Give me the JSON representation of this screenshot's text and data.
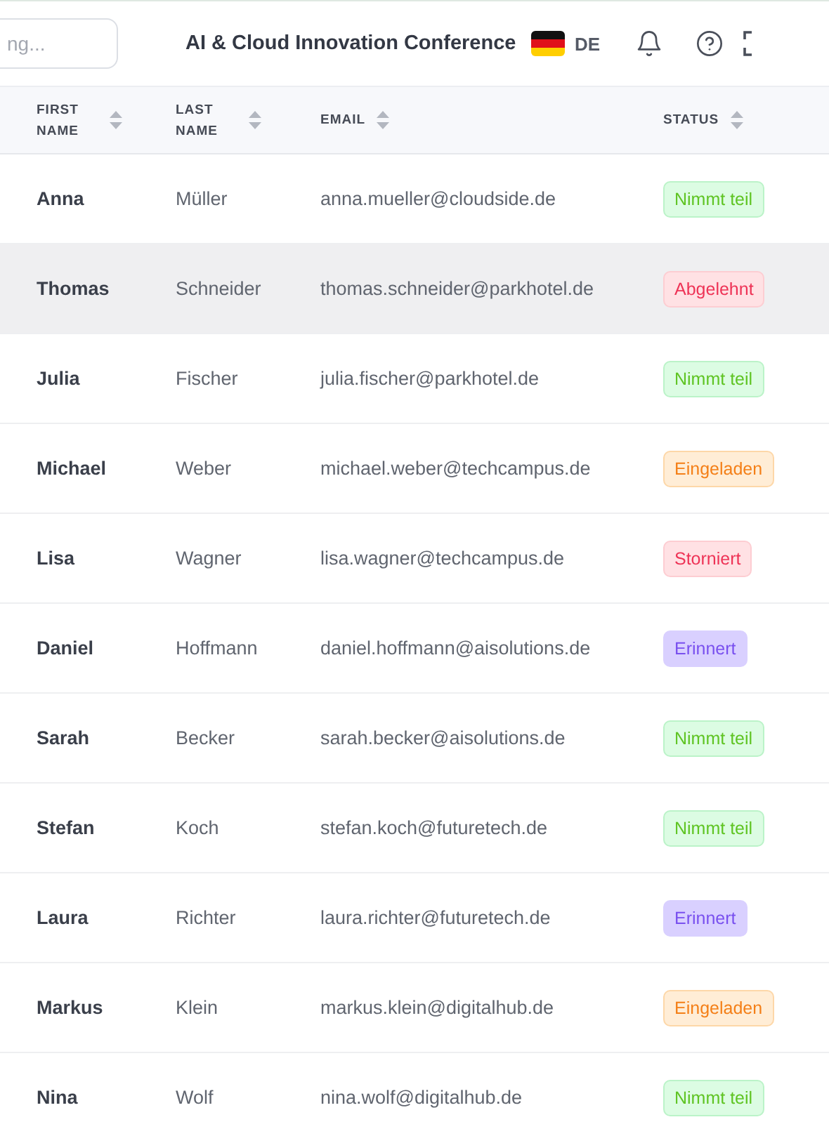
{
  "header": {
    "search": {
      "placeholder": "ng..."
    },
    "title": "AI & Cloud Innovation Conference",
    "language": "DE"
  },
  "table": {
    "columns": [
      {
        "label": "FIRST NAME"
      },
      {
        "label": "LAST NAME"
      },
      {
        "label": "EMAIL"
      },
      {
        "label": "STATUS"
      }
    ],
    "rows": [
      {
        "first_name": "Anna",
        "last_name": "Müller",
        "email": "anna.mueller@cloudside.de",
        "status": "Nimmt teil",
        "kind": "accepted",
        "hovered": false
      },
      {
        "first_name": "Thomas",
        "last_name": "Schneider",
        "email": "thomas.schneider@parkhotel.de",
        "status": "Abgelehnt",
        "kind": "declined",
        "hovered": true
      },
      {
        "first_name": "Julia",
        "last_name": "Fischer",
        "email": "julia.fischer@parkhotel.de",
        "status": "Nimmt teil",
        "kind": "accepted",
        "hovered": false
      },
      {
        "first_name": "Michael",
        "last_name": "Weber",
        "email": "michael.weber@techcampus.de",
        "status": "Eingeladen",
        "kind": "invited",
        "hovered": false
      },
      {
        "first_name": "Lisa",
        "last_name": "Wagner",
        "email": "lisa.wagner@techcampus.de",
        "status": "Storniert",
        "kind": "declined",
        "hovered": false
      },
      {
        "first_name": "Daniel",
        "last_name": "Hoffmann",
        "email": "daniel.hoffmann@aisolutions.de",
        "status": "Erinnert",
        "kind": "reminded",
        "hovered": false
      },
      {
        "first_name": "Sarah",
        "last_name": "Becker",
        "email": "sarah.becker@aisolutions.de",
        "status": "Nimmt teil",
        "kind": "accepted",
        "hovered": false
      },
      {
        "first_name": "Stefan",
        "last_name": "Koch",
        "email": "stefan.koch@futuretech.de",
        "status": "Nimmt teil",
        "kind": "accepted",
        "hovered": false
      },
      {
        "first_name": "Laura",
        "last_name": "Richter",
        "email": "laura.richter@futuretech.de",
        "status": "Erinnert",
        "kind": "reminded",
        "hovered": false
      },
      {
        "first_name": "Markus",
        "last_name": "Klein",
        "email": "markus.klein@digitalhub.de",
        "status": "Eingeladen",
        "kind": "invited",
        "hovered": false
      },
      {
        "first_name": "Nina",
        "last_name": "Wolf",
        "email": "nina.wolf@digitalhub.de",
        "status": "Nimmt teil",
        "kind": "accepted",
        "hovered": false
      }
    ]
  }
}
